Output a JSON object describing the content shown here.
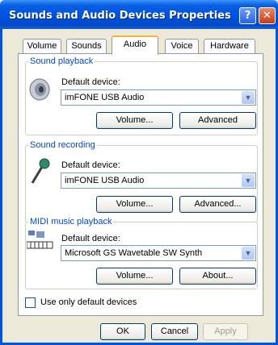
{
  "window": {
    "title": "Sounds and Audio Devices Properties",
    "help_glyph": "?",
    "close_glyph": "✕"
  },
  "tabs": [
    "Volume",
    "Sounds",
    "Audio",
    "Voice",
    "Hardware"
  ],
  "active_tab": "Audio",
  "sound_playback": {
    "label": "Sound playback",
    "device_label": "Default device:",
    "device": "imFONE USB Audio",
    "volume_button": "Volume...",
    "advanced_button": "Advanced",
    "icon": "speaker-icon"
  },
  "sound_recording": {
    "label": "Sound recording",
    "device_label": "Default device:",
    "device": "imFONE USB Audio",
    "volume_button": "Volume...",
    "advanced_button": "Advanced...",
    "icon": "microphone-icon"
  },
  "midi_playback": {
    "label": "MIDI music playback",
    "device_label": "Default device:",
    "device": "Microsoft GS Wavetable SW Synth",
    "volume_button": "Volume...",
    "about_button": "About...",
    "icon": "midi-keyboard-icon"
  },
  "use_default_devices": {
    "label": "Use only default devices",
    "checked": false
  },
  "buttons": {
    "ok": "OK",
    "cancel": "Cancel",
    "apply": "Apply"
  },
  "colors": {
    "titlebar": "#0054e3",
    "group_label": "#0046d5",
    "tab_accent": "#f7b23c"
  }
}
